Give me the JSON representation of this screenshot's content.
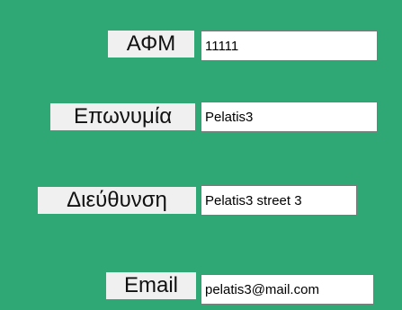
{
  "form": {
    "afm": {
      "label": "ΑΦΜ",
      "value": "11111"
    },
    "eponymia": {
      "label": "Επωνυμία",
      "value": "Pelatis3"
    },
    "dieythynsi": {
      "label": "Διεύθυνση",
      "value": "Pelatis3 street 3"
    },
    "email": {
      "label": "Email",
      "value": "pelatis3@mail.com"
    }
  },
  "colors": {
    "background": "#2fa876",
    "label_background": "#f0f0f0",
    "field_background": "#ffffff"
  }
}
